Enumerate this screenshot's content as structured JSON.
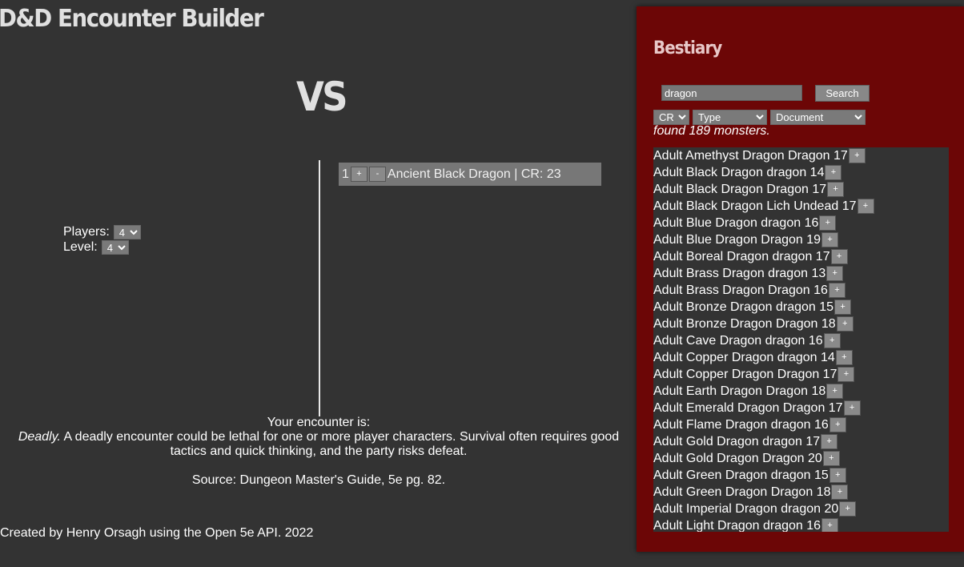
{
  "app": {
    "title": "D&D Encounter Builder",
    "vs": "VS"
  },
  "party": {
    "players_label": "Players:",
    "players_value": "4",
    "level_label": "Level:",
    "level_value": "4"
  },
  "encounter": {
    "items": [
      {
        "count": "1",
        "plus": "+",
        "minus": "-",
        "description": "Ancient Black Dragon | CR: 23"
      }
    ]
  },
  "result": {
    "heading": "Your encounter is:",
    "rating": "Deadly.",
    "description": "A deadly encounter could be lethal for one or more player characters. Survival often requires good tactics and quick thinking, and the party risks defeat.",
    "source": "Source: Dungeon Master's Guide, 5e pg. 82."
  },
  "footer": {
    "text": "Created by Henry Orsagh using the Open 5e API. 2022"
  },
  "bestiary": {
    "title": "Bestiary",
    "search_value": "dragon",
    "search_button": "Search",
    "filters": {
      "cr": "CR",
      "type": "Type",
      "document": "Document"
    },
    "found_text": "found 189 monsters.",
    "add_label": "+",
    "monsters": [
      "Adult Amethyst Dragon Dragon 17",
      "Adult Black Dragon dragon 14",
      "Adult Black Dragon Dragon 17",
      "Adult Black Dragon Lich Undead 17",
      "Adult Blue Dragon dragon 16",
      "Adult Blue Dragon Dragon 19",
      "Adult Boreal Dragon dragon 17",
      "Adult Brass Dragon dragon 13",
      "Adult Brass Dragon Dragon 16",
      "Adult Bronze Dragon dragon 15",
      "Adult Bronze Dragon Dragon 18",
      "Adult Cave Dragon dragon 16",
      "Adult Copper Dragon dragon 14",
      "Adult Copper Dragon Dragon 17",
      "Adult Earth Dragon Dragon 18",
      "Adult Emerald Dragon Dragon 17",
      "Adult Flame Dragon dragon 16",
      "Adult Gold Dragon dragon 17",
      "Adult Gold Dragon Dragon 20",
      "Adult Green Dragon dragon 15",
      "Adult Green Dragon Dragon 18",
      "Adult Imperial Dragon dragon 20",
      "Adult Light Dragon dragon 16"
    ]
  },
  "colors": {
    "background": "#333333",
    "bestiary_panel": "#6c0606",
    "encounter_item": "#777777",
    "button": "#888888"
  }
}
